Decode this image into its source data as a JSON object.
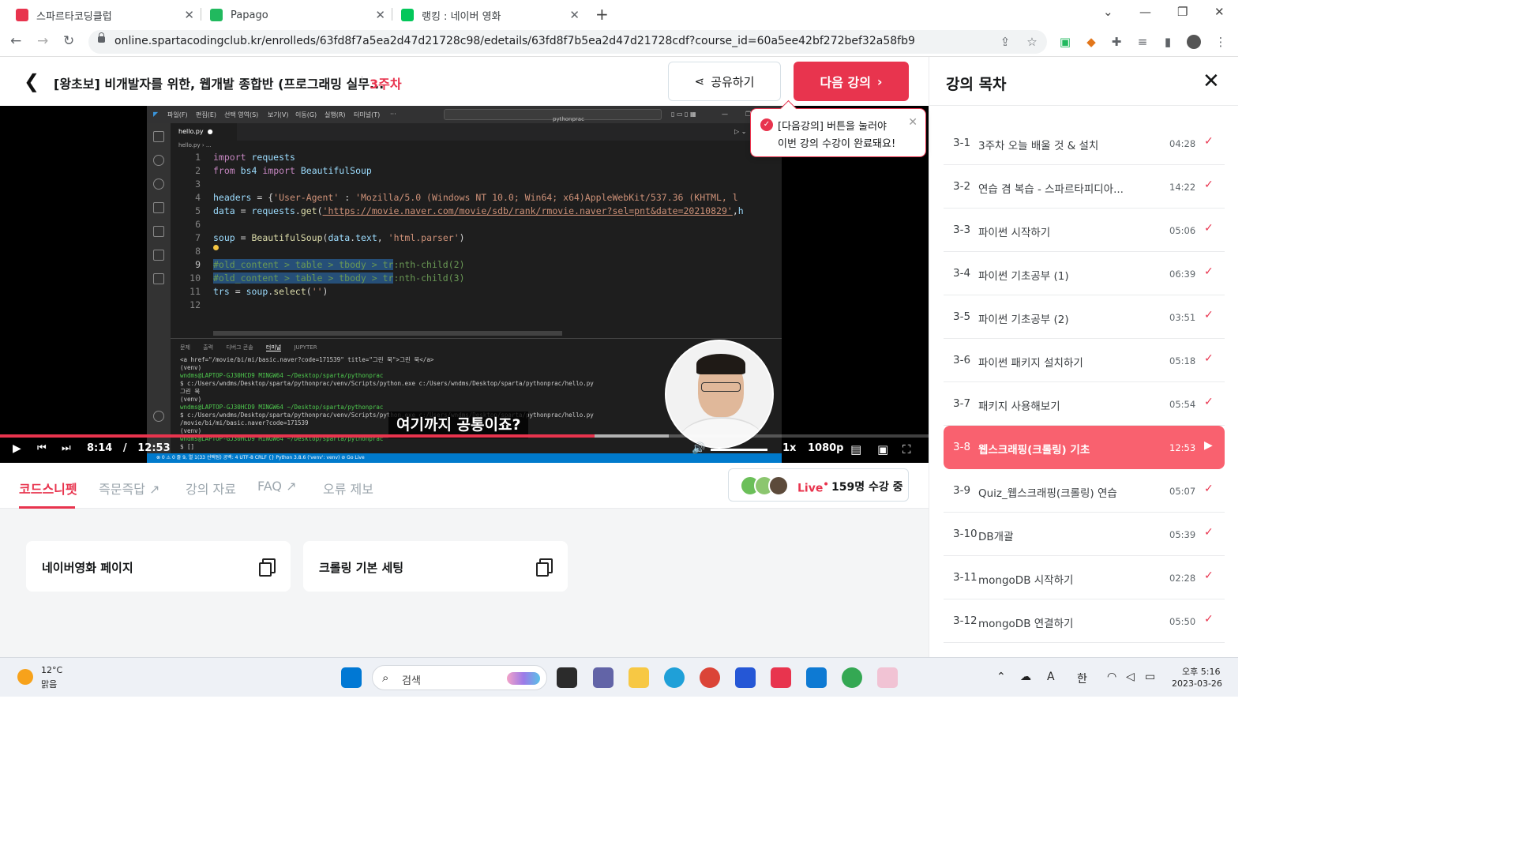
{
  "browser": {
    "tabs": [
      {
        "title": "스파르타코딩클럽",
        "favicon_color": "#e8344e",
        "active": true
      },
      {
        "title": "Papago",
        "favicon_color": "#21b95e",
        "active": false
      },
      {
        "title": "랭킹 : 네이버 영화",
        "favicon_color": "#03c75a",
        "active": false
      }
    ],
    "url": "online.spartacodingclub.kr/enrolleds/63fd8f7a5ea2d47d21728c98/edetails/63fd8f7b5ea2d47d21728cdf?course_id=60a5ee42bf272bef32a58fb9"
  },
  "header": {
    "course_title": "[왕초보] 비개발자를 위한, 웹개발 종합반 (프로그래밍 실무...",
    "week": "3주차",
    "share_label": "공유하기",
    "next_label": "다음 강의"
  },
  "tooltip": {
    "highlight": "[다음강의]",
    "line1_rest": " 버튼을 눌러야",
    "line2": "이번 강의 수강이 완료돼요!"
  },
  "player": {
    "subtitle": "여기까지 공통이죠?",
    "current_time": "8:14",
    "time_separator": "/",
    "duration": "12:53",
    "progress_fraction": 0.64,
    "buffered_fraction": 0.72,
    "speed": "1x",
    "quality": "1080p",
    "volume_fraction": 1.0
  },
  "vscode": {
    "menu": [
      "파일(F)",
      "편집(E)",
      "선택 영역(S)",
      "보기(V)",
      "이동(G)",
      "실행(R)",
      "터미널(T)",
      "···"
    ],
    "search": "pythonprac",
    "tab": "hello.py",
    "breadcrumb": "hello.py › ...",
    "line_numbers": [
      "1",
      "2",
      "3",
      "4",
      "5",
      "6",
      "7",
      "8",
      "9",
      "10",
      "11",
      "12"
    ],
    "panel_tabs": [
      "문제",
      "출력",
      "디버그 콘솔",
      "터미널",
      "JUPYTER"
    ],
    "terminal_lines": [
      "<a href=\"/movie/bi/mi/basic.naver?code=171539\" title=\"그린 북\">그린 북</a>",
      "(venv)",
      "wndms@LAPTOP-GJ30HCD9 MINGW64 ~/Desktop/sparta/pythonprac",
      "$ c:/Users/wndms/Desktop/sparta/pythonprac/venv/Scripts/python.exe c:/Users/wndms/Desktop/sparta/pythonprac/hello.py",
      "그린 북",
      "(venv)",
      "wndms@LAPTOP-GJ30HCD9 MINGW64 ~/Desktop/sparta/pythonprac",
      "$ c:/Users/wndms/Desktop/sparta/pythonprac/venv/Scripts/python.exe c:/Users/wndms/Desktop/sparta/pythonprac/hello.py",
      "/movie/bi/mi/basic.naver?code=171539",
      "(venv)",
      "wndms@LAPTOP-GJ30HCD9 MINGW64 ~/Desktop/sparta/pythonprac",
      "$ []"
    ],
    "status": "⊗ 0 ⚠ 0          줄 9, 열 1(33 선택됨)   공백: 4   UTF-8   CRLF   {} Python   3.8.6 ('venv': venv)   ⊘ Go Live"
  },
  "lecture_tabs": [
    {
      "label": "코드스니펫",
      "active": true
    },
    {
      "label": "즉문즉답 ↗",
      "active": false
    },
    {
      "label": "강의 자료",
      "active": false
    },
    {
      "label": "FAQ ↗",
      "active": false
    },
    {
      "label": "오류 제보",
      "active": false
    }
  ],
  "live": {
    "label": "Live",
    "dot": "•",
    "count": "159명 수강 중"
  },
  "snippets": [
    {
      "label": "네이버영화 페이지"
    },
    {
      "label": "크롤링 기본 세팅"
    }
  ],
  "toc": {
    "title": "강의 목차",
    "items": [
      {
        "num": "3-1",
        "name": "3주차 오늘 배울 것 & 설치",
        "duration": "04:28",
        "status": "done"
      },
      {
        "num": "3-2",
        "name": "연습 겸 복습 - 스파르타피디아...",
        "duration": "14:22",
        "status": "done"
      },
      {
        "num": "3-3",
        "name": "파이썬 시작하기",
        "duration": "05:06",
        "status": "done"
      },
      {
        "num": "3-4",
        "name": "파이썬 기초공부 (1)",
        "duration": "06:39",
        "status": "done"
      },
      {
        "num": "3-5",
        "name": "파이썬 기초공부 (2)",
        "duration": "03:51",
        "status": "done"
      },
      {
        "num": "3-6",
        "name": "파이썬 패키지 설치하기",
        "duration": "05:18",
        "status": "done"
      },
      {
        "num": "3-7",
        "name": "패키지 사용해보기",
        "duration": "05:54",
        "status": "done"
      },
      {
        "num": "3-8",
        "name": "웹스크래핑(크롤링) 기초",
        "duration": "12:53",
        "status": "playing"
      },
      {
        "num": "3-9",
        "name": "Quiz_웹스크래핑(크롤링) 연습",
        "duration": "05:07",
        "status": "done"
      },
      {
        "num": "3-10",
        "name": "DB개괄",
        "duration": "05:39",
        "status": "done"
      },
      {
        "num": "3-11",
        "name": "mongoDB 시작하기",
        "duration": "02:28",
        "status": "done"
      },
      {
        "num": "3-12",
        "name": "mongoDB 연결하기",
        "duration": "05:50",
        "status": "done"
      }
    ]
  },
  "taskbar": {
    "temperature": "12°C",
    "weather": "맑음",
    "search_placeholder": "검색",
    "ime": "한",
    "time": "오후 5:16",
    "date": "2023-03-26"
  },
  "colors": {
    "accent": "#e8344e",
    "toc_current": "#f9616f"
  }
}
